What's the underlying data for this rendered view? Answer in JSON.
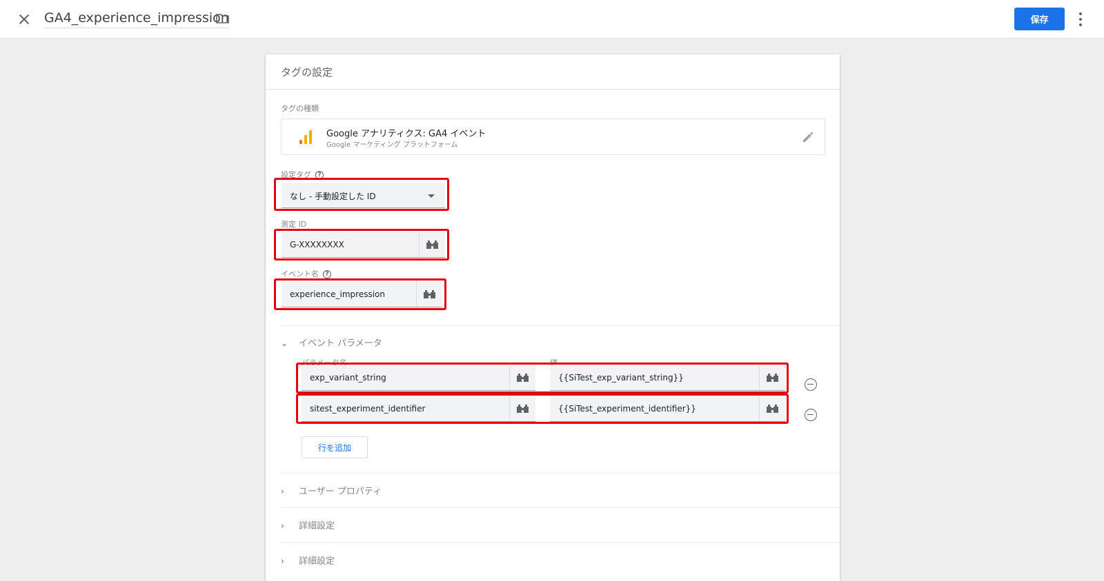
{
  "header": {
    "title": "GA4_experience_impression",
    "save_label": "保存"
  },
  "card": {
    "title": "タグの設定",
    "tag_type_label": "タグの種類",
    "tag_type_name": "Google アナリティクス: GA4 イベント",
    "tag_type_sub": "Google マーケティング プラットフォーム",
    "config_tag_label": "設定タグ",
    "config_tag_value": "なし - 手動設定した ID",
    "measurement_id_label": "測定 ID",
    "measurement_id_value": "G-XXXXXXXX",
    "event_name_label": "イベント名",
    "event_name_value": "experience_impression",
    "event_params_section": "イベント パラメータ",
    "param_name_header": "パラメータ名",
    "value_header": "値",
    "params": [
      {
        "name": "exp_variant_string",
        "value": "{{SiTest_exp_variant_string}}"
      },
      {
        "name": "sitest_experiment_identifier",
        "value": "{{SiTest_experiment_identifier}}"
      }
    ],
    "add_row_label": "行を追加",
    "sections": [
      "ユーザー プロパティ",
      "詳細設定",
      "詳細設定"
    ]
  },
  "icons": {
    "close": "close-icon",
    "folder": "folder-icon",
    "more": "more-vert-icon",
    "analytics": "google-analytics-icon",
    "edit": "pencil-icon",
    "variable": "variable-icon",
    "remove": "remove-circle-icon",
    "help": "help-icon"
  },
  "colors": {
    "primary": "#1a73e8",
    "highlight": "#e60012",
    "analytics_orange": "#f9ab00",
    "analytics_dark_orange": "#e37400"
  }
}
